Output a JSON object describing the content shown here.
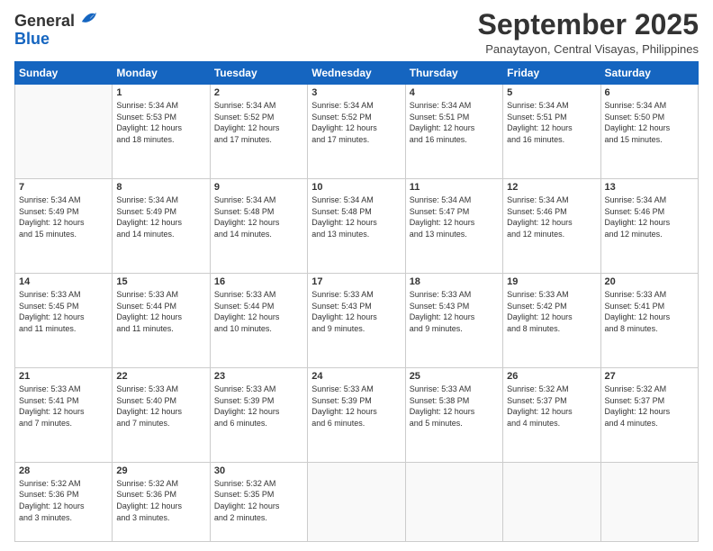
{
  "header": {
    "logo_general": "General",
    "logo_blue": "Blue",
    "month_title": "September 2025",
    "subtitle": "Panaytayon, Central Visayas, Philippines"
  },
  "days_of_week": [
    "Sunday",
    "Monday",
    "Tuesday",
    "Wednesday",
    "Thursday",
    "Friday",
    "Saturday"
  ],
  "weeks": [
    [
      {
        "day": "",
        "info": ""
      },
      {
        "day": "1",
        "info": "Sunrise: 5:34 AM\nSunset: 5:53 PM\nDaylight: 12 hours\nand 18 minutes."
      },
      {
        "day": "2",
        "info": "Sunrise: 5:34 AM\nSunset: 5:52 PM\nDaylight: 12 hours\nand 17 minutes."
      },
      {
        "day": "3",
        "info": "Sunrise: 5:34 AM\nSunset: 5:52 PM\nDaylight: 12 hours\nand 17 minutes."
      },
      {
        "day": "4",
        "info": "Sunrise: 5:34 AM\nSunset: 5:51 PM\nDaylight: 12 hours\nand 16 minutes."
      },
      {
        "day": "5",
        "info": "Sunrise: 5:34 AM\nSunset: 5:51 PM\nDaylight: 12 hours\nand 16 minutes."
      },
      {
        "day": "6",
        "info": "Sunrise: 5:34 AM\nSunset: 5:50 PM\nDaylight: 12 hours\nand 15 minutes."
      }
    ],
    [
      {
        "day": "7",
        "info": "Sunrise: 5:34 AM\nSunset: 5:49 PM\nDaylight: 12 hours\nand 15 minutes."
      },
      {
        "day": "8",
        "info": "Sunrise: 5:34 AM\nSunset: 5:49 PM\nDaylight: 12 hours\nand 14 minutes."
      },
      {
        "day": "9",
        "info": "Sunrise: 5:34 AM\nSunset: 5:48 PM\nDaylight: 12 hours\nand 14 minutes."
      },
      {
        "day": "10",
        "info": "Sunrise: 5:34 AM\nSunset: 5:48 PM\nDaylight: 12 hours\nand 13 minutes."
      },
      {
        "day": "11",
        "info": "Sunrise: 5:34 AM\nSunset: 5:47 PM\nDaylight: 12 hours\nand 13 minutes."
      },
      {
        "day": "12",
        "info": "Sunrise: 5:34 AM\nSunset: 5:46 PM\nDaylight: 12 hours\nand 12 minutes."
      },
      {
        "day": "13",
        "info": "Sunrise: 5:34 AM\nSunset: 5:46 PM\nDaylight: 12 hours\nand 12 minutes."
      }
    ],
    [
      {
        "day": "14",
        "info": "Sunrise: 5:33 AM\nSunset: 5:45 PM\nDaylight: 12 hours\nand 11 minutes."
      },
      {
        "day": "15",
        "info": "Sunrise: 5:33 AM\nSunset: 5:44 PM\nDaylight: 12 hours\nand 11 minutes."
      },
      {
        "day": "16",
        "info": "Sunrise: 5:33 AM\nSunset: 5:44 PM\nDaylight: 12 hours\nand 10 minutes."
      },
      {
        "day": "17",
        "info": "Sunrise: 5:33 AM\nSunset: 5:43 PM\nDaylight: 12 hours\nand 9 minutes."
      },
      {
        "day": "18",
        "info": "Sunrise: 5:33 AM\nSunset: 5:43 PM\nDaylight: 12 hours\nand 9 minutes."
      },
      {
        "day": "19",
        "info": "Sunrise: 5:33 AM\nSunset: 5:42 PM\nDaylight: 12 hours\nand 8 minutes."
      },
      {
        "day": "20",
        "info": "Sunrise: 5:33 AM\nSunset: 5:41 PM\nDaylight: 12 hours\nand 8 minutes."
      }
    ],
    [
      {
        "day": "21",
        "info": "Sunrise: 5:33 AM\nSunset: 5:41 PM\nDaylight: 12 hours\nand 7 minutes."
      },
      {
        "day": "22",
        "info": "Sunrise: 5:33 AM\nSunset: 5:40 PM\nDaylight: 12 hours\nand 7 minutes."
      },
      {
        "day": "23",
        "info": "Sunrise: 5:33 AM\nSunset: 5:39 PM\nDaylight: 12 hours\nand 6 minutes."
      },
      {
        "day": "24",
        "info": "Sunrise: 5:33 AM\nSunset: 5:39 PM\nDaylight: 12 hours\nand 6 minutes."
      },
      {
        "day": "25",
        "info": "Sunrise: 5:33 AM\nSunset: 5:38 PM\nDaylight: 12 hours\nand 5 minutes."
      },
      {
        "day": "26",
        "info": "Sunrise: 5:32 AM\nSunset: 5:37 PM\nDaylight: 12 hours\nand 4 minutes."
      },
      {
        "day": "27",
        "info": "Sunrise: 5:32 AM\nSunset: 5:37 PM\nDaylight: 12 hours\nand 4 minutes."
      }
    ],
    [
      {
        "day": "28",
        "info": "Sunrise: 5:32 AM\nSunset: 5:36 PM\nDaylight: 12 hours\nand 3 minutes."
      },
      {
        "day": "29",
        "info": "Sunrise: 5:32 AM\nSunset: 5:36 PM\nDaylight: 12 hours\nand 3 minutes."
      },
      {
        "day": "30",
        "info": "Sunrise: 5:32 AM\nSunset: 5:35 PM\nDaylight: 12 hours\nand 2 minutes."
      },
      {
        "day": "",
        "info": ""
      },
      {
        "day": "",
        "info": ""
      },
      {
        "day": "",
        "info": ""
      },
      {
        "day": "",
        "info": ""
      }
    ]
  ]
}
